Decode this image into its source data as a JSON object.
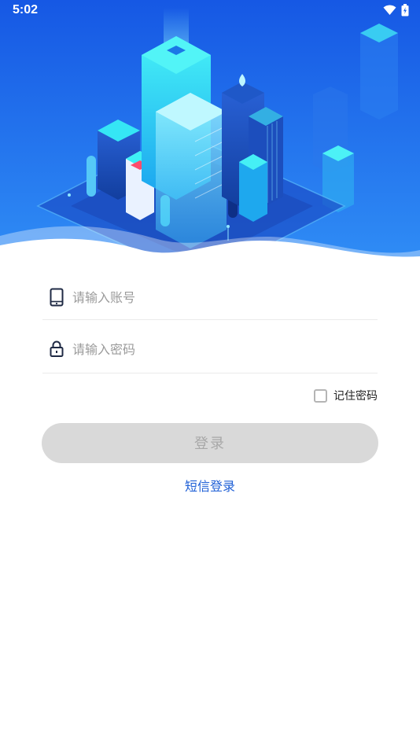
{
  "status_bar": {
    "time": "5:02",
    "icons": [
      "wifi-icon",
      "battery-charging-icon"
    ]
  },
  "hero": {
    "illustration": "isometric-city-illustration",
    "colors": {
      "sky_top": "#1a63e8",
      "sky_bottom": "#2b86f3",
      "accent_cyan": "#35e6f5",
      "wave": "#ffffff"
    }
  },
  "form": {
    "account": {
      "icon": "phone-icon",
      "placeholder": "请输入账号",
      "value": ""
    },
    "password": {
      "icon": "lock-icon",
      "placeholder": "请输入密码",
      "value": ""
    },
    "remember": {
      "label": "记住密码",
      "checked": false
    },
    "login_button": {
      "label": "登录",
      "enabled": false,
      "bg_color": "#d9d9d9"
    },
    "sms_login": {
      "label": "短信登录",
      "color": "#1e5fd6"
    }
  }
}
